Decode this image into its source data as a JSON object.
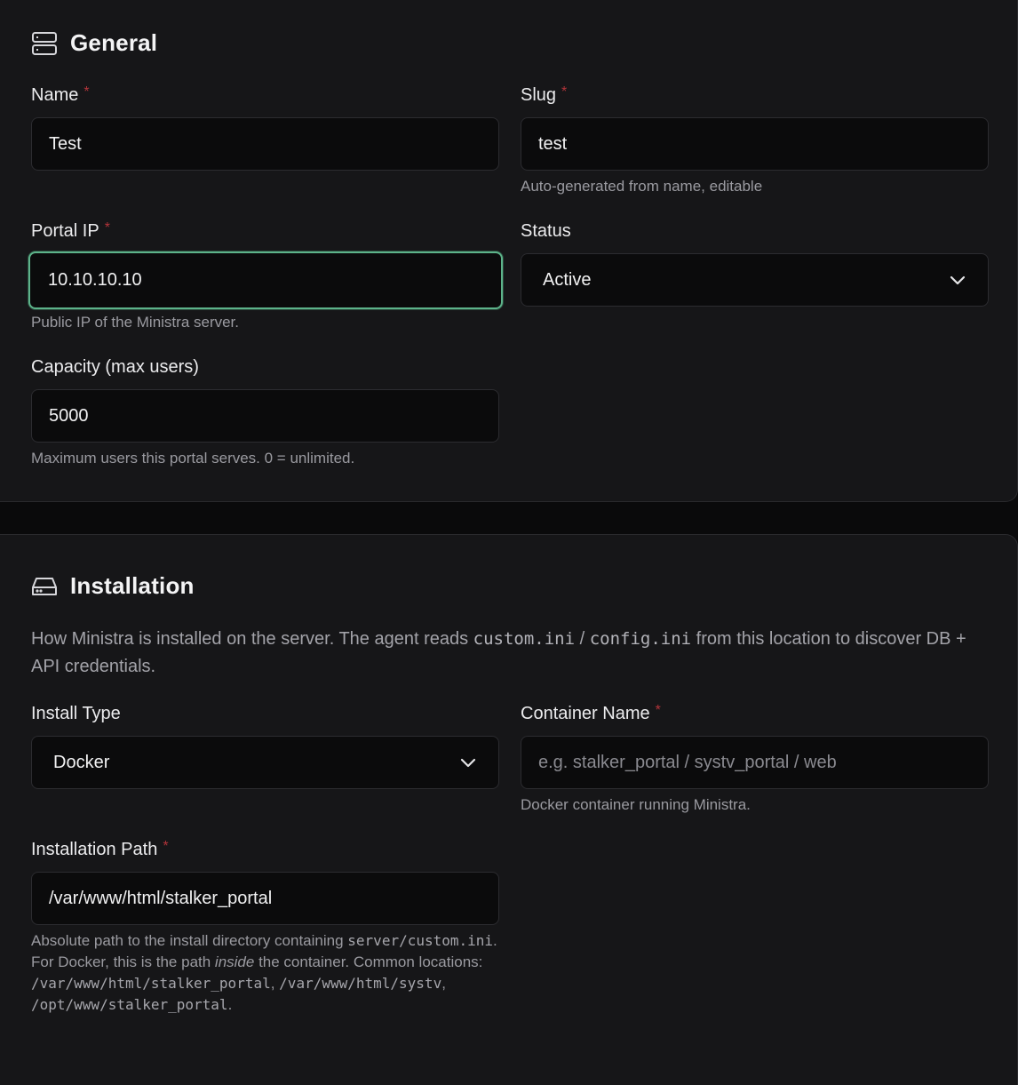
{
  "general": {
    "title": "General",
    "icon": "server-icon",
    "name": {
      "label": "Name",
      "required": "*",
      "value": "Test"
    },
    "slug": {
      "label": "Slug",
      "required": "*",
      "value": "test",
      "hint": "Auto-generated from name, editable"
    },
    "portal_ip": {
      "label": "Portal IP",
      "required": "*",
      "value": "10.10.10.10",
      "hint": "Public IP of the Ministra server."
    },
    "status": {
      "label": "Status",
      "value": "Active"
    },
    "capacity": {
      "label": "Capacity (max users)",
      "value": "5000",
      "hint": "Maximum users this portal serves. 0 = unlimited."
    }
  },
  "installation": {
    "title": "Installation",
    "icon": "hard-drive-icon",
    "desc_pre": "How Ministra is installed on the server. The agent reads ",
    "desc_code1": "custom.ini",
    "desc_sep": " / ",
    "desc_code2": "config.ini",
    "desc_post": " from this location to discover DB + API credentials.",
    "install_type": {
      "label": "Install Type",
      "value": "Docker"
    },
    "container_name": {
      "label": "Container Name",
      "required": "*",
      "placeholder": "e.g. stalker_portal / systv_portal / web",
      "hint": "Docker container running Ministra."
    },
    "install_path": {
      "label": "Installation Path",
      "required": "*",
      "value": "/var/www/html/stalker_portal",
      "hint_pre": "Absolute path to the install directory containing ",
      "hint_code1": "server/custom.ini",
      "hint_mid": ". For Docker, this is the path ",
      "hint_em": "inside",
      "hint_mid2": " the container. Common locations: ",
      "hint_code2": "/var/www/html/stalker_portal",
      "hint_comma1": ", ",
      "hint_code3": "/var/www/html/systv",
      "hint_comma2": ", ",
      "hint_code4": "/opt/www/stalker_portal",
      "hint_end": "."
    }
  },
  "colors": {
    "background": "#0a0a0b",
    "card": "#161618",
    "input": "#0b0b0c",
    "focus_ring": "#5db38a",
    "required": "#b3343a"
  }
}
